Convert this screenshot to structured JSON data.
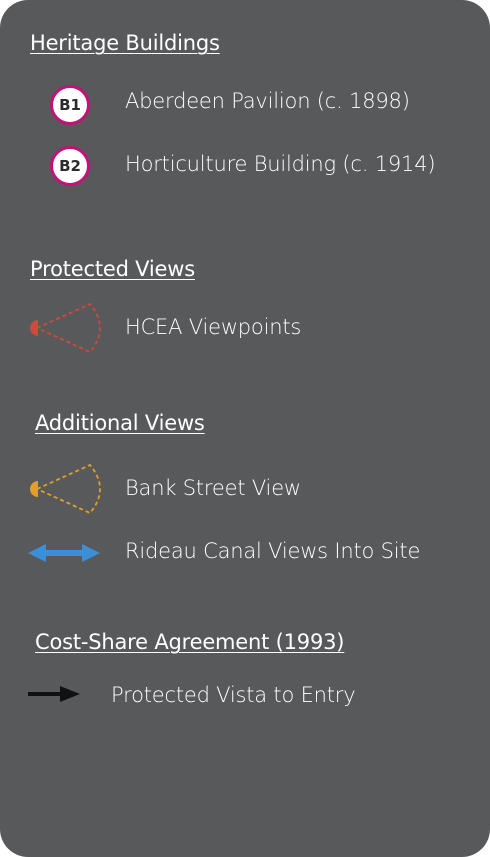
{
  "sections": {
    "heritage": {
      "title": "Heritage Buildings",
      "items": [
        {
          "badge": "B1",
          "label": "Aberdeen Pavilion (c. 1898)"
        },
        {
          "badge": "B2",
          "label": "Horticulture Building (c. 1914)"
        }
      ]
    },
    "protected": {
      "title": "Protected Views",
      "items": [
        {
          "icon": "red-viewpoint-cone-icon",
          "label": "HCEA Viewpoints",
          "color": "#cf4a3c"
        }
      ]
    },
    "additional": {
      "title": "Additional  Views",
      "items": [
        {
          "icon": "orange-viewpoint-cone-icon",
          "label": "Bank Street View",
          "color": "#e0a024"
        },
        {
          "icon": "blue-double-arrow-icon",
          "label": "Rideau Canal Views Into Site",
          "color": "#3c8fd6"
        }
      ]
    },
    "costshare": {
      "title": "Cost-Share Agreement (1993)",
      "items": [
        {
          "icon": "black-arrow-icon",
          "label": "Protected Vista to Entry",
          "color": "#111111"
        }
      ]
    }
  },
  "colors": {
    "panel": "#58595b",
    "badge_border": "#c4117a"
  }
}
